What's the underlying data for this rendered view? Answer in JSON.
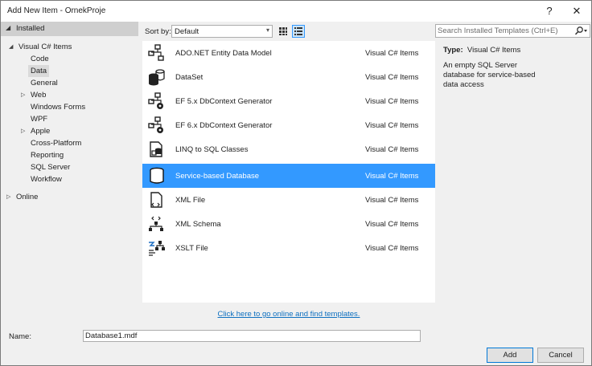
{
  "window": {
    "title": "Add New Item - OrnekProje",
    "help_label": "?",
    "close_label": "✕"
  },
  "tree": {
    "installed_label": "Installed",
    "visual_csharp_label": "Visual C# Items",
    "items": [
      "Code",
      "Data",
      "General",
      "Web",
      "Windows Forms",
      "WPF",
      "Apple",
      "Cross-Platform",
      "Reporting",
      "SQL Server",
      "Workflow"
    ],
    "selected_item": "Data",
    "online_label": "Online"
  },
  "sort": {
    "label": "Sort by:",
    "value": "Default"
  },
  "search": {
    "placeholder": "Search Installed Templates (Ctrl+E)"
  },
  "templates": [
    {
      "name": "ADO.NET Entity Data Model",
      "category": "Visual C# Items",
      "icon": "entity-model-icon"
    },
    {
      "name": "DataSet",
      "category": "Visual C# Items",
      "icon": "dataset-icon"
    },
    {
      "name": "EF 5.x DbContext Generator",
      "category": "Visual C# Items",
      "icon": "dbcontext-generator-icon"
    },
    {
      "name": "EF 6.x DbContext Generator",
      "category": "Visual C# Items",
      "icon": "dbcontext-generator-icon"
    },
    {
      "name": "LINQ to SQL Classes",
      "category": "Visual C# Items",
      "icon": "linq-classes-icon"
    },
    {
      "name": "Service-based Database",
      "category": "Visual C# Items",
      "icon": "database-icon",
      "selected": true
    },
    {
      "name": "XML File",
      "category": "Visual C# Items",
      "icon": "xml-file-icon"
    },
    {
      "name": "XML Schema",
      "category": "Visual C# Items",
      "icon": "xml-schema-icon"
    },
    {
      "name": "XSLT File",
      "category": "Visual C# Items",
      "icon": "xslt-file-icon"
    }
  ],
  "online_link": "Click here to go online and find templates.",
  "details": {
    "type_label": "Type:",
    "type_value": "Visual C# Items",
    "description": "An empty SQL Server database for service-based data access"
  },
  "name_field": {
    "label": "Name:",
    "value": "Database1.mdf"
  },
  "buttons": {
    "add": "Add",
    "cancel": "Cancel"
  },
  "colors": {
    "selection": "#3399ff",
    "link": "#0e70c0",
    "installed_header": "#cfcfcf"
  }
}
